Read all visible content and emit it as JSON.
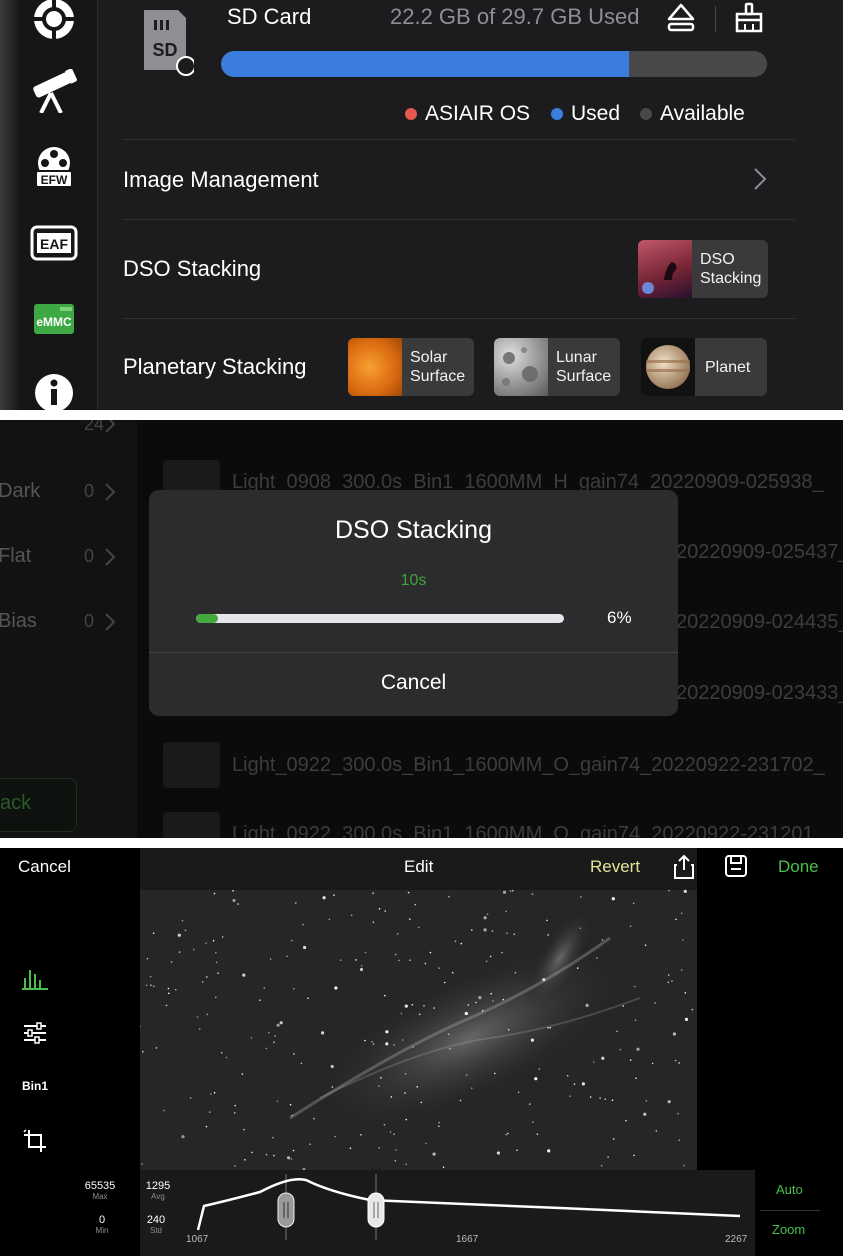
{
  "panel1": {
    "sd_card": {
      "badge_text": "SD",
      "title": "SD Card",
      "usage_text": "22.2 GB of 29.7 GB Used",
      "used_fraction": 0.747
    },
    "legend": [
      {
        "label": "ASIAIR OS",
        "color": "#e5574f"
      },
      {
        "label": "Used",
        "color": "#3b7ddd"
      },
      {
        "label": "Available",
        "color": "#48484a"
      }
    ],
    "sidebar_icons": {
      "efw": "EFW",
      "eaf": "EAF",
      "emmc": "eMMC"
    },
    "rows": {
      "image_management": "Image Management",
      "dso_stacking": "DSO Stacking",
      "planetary_stacking": "Planetary Stacking"
    },
    "tiles": {
      "dso": "DSO Stacking",
      "solar": "Solar Surface",
      "lunar": "Lunar Surface",
      "planet": "Planet"
    }
  },
  "panel2": {
    "frames": [
      {
        "label": "",
        "count": "24"
      },
      {
        "label": "Dark",
        "count": "0"
      },
      {
        "label": "Flat",
        "count": "0"
      },
      {
        "label": "Bias",
        "count": "0"
      }
    ],
    "files": [
      "Light_0908_300.0s_Bin1_1600MM_H_gain74_20220909-025938_",
      "20220909-025437_",
      "20220909-024435_",
      "20220909-023433_",
      "Light_0922_300.0s_Bin1_1600MM_O_gain74_20220922-231702_",
      "Light_0922_300.0s_Bin1_1600MM_O_gain74_20220922-231201"
    ],
    "back_text": "ack",
    "dialog": {
      "title": "DSO Stacking",
      "time": "10s",
      "progress_fraction": 0.06,
      "progress_text": "6%",
      "cancel": "Cancel"
    }
  },
  "panel3": {
    "toolbar": {
      "cancel": "Cancel",
      "title": "Edit",
      "revert": "Revert",
      "done": "Done"
    },
    "tools": {
      "bin": "Bin1"
    },
    "stats": {
      "max_value": "65535",
      "max_label": "Max",
      "min_value": "0",
      "min_label": "Min",
      "avg_value": "1295",
      "avg_label": "Avg",
      "std_value": "240",
      "std_label": "Std"
    },
    "axis": {
      "left": "1067",
      "mid": "1667",
      "right": "2267"
    },
    "side_buttons": {
      "auto": "Auto",
      "zoom": "Zoom"
    },
    "colors": {
      "accent_green": "#4bbf4b",
      "revert_yellow": "#e6e49a"
    }
  }
}
